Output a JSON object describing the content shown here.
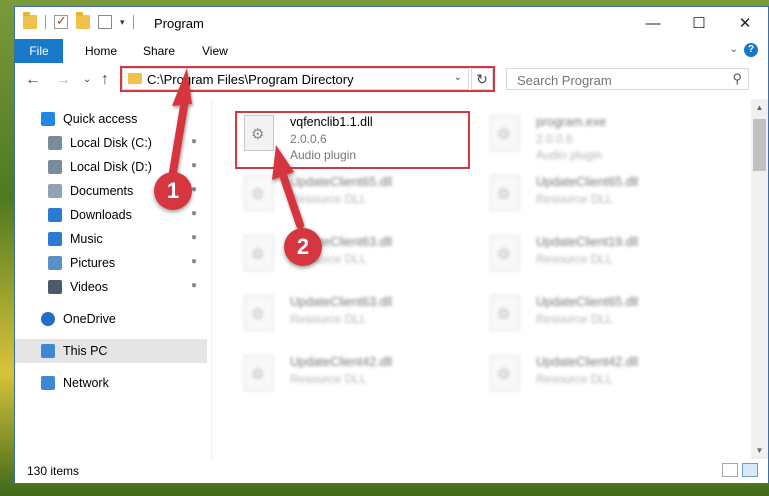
{
  "window": {
    "title": "Program",
    "controls": {
      "minimize": "—",
      "maximize": "☐",
      "close": "✕"
    }
  },
  "ribbon": {
    "tabs": [
      "File",
      "Home",
      "Share",
      "View"
    ],
    "help_icon": "?",
    "expand_icon": "⌄"
  },
  "nav": {
    "back": "←",
    "forward": "→",
    "recent": "⌄",
    "up": "↑",
    "address": "C:\\Program Files\\Program Directory",
    "address_caret": "⌄",
    "refresh": "↻",
    "search_placeholder": "Search Program",
    "search_icon": "⚲"
  },
  "sidebar": {
    "items": [
      {
        "label": "Quick access",
        "icon": "star-icon",
        "color": "#1e88e5"
      },
      {
        "label": "Local Disk (C:)",
        "icon": "drive-icon",
        "color": "#7a8b99",
        "pinned": true
      },
      {
        "label": "Local Disk (D:)",
        "icon": "drive-icon",
        "color": "#7a8b99",
        "pinned": true
      },
      {
        "label": "Documents",
        "icon": "documents-icon",
        "color": "#8fa3b5",
        "pinned": true
      },
      {
        "label": "Downloads",
        "icon": "downloads-icon",
        "color": "#2a7bd1",
        "pinned": true
      },
      {
        "label": "Music",
        "icon": "music-icon",
        "color": "#2a7bd1",
        "pinned": true
      },
      {
        "label": "Pictures",
        "icon": "pictures-icon",
        "color": "#5b8fc7",
        "pinned": true
      },
      {
        "label": "Videos",
        "icon": "videos-icon",
        "color": "#4a5a6a",
        "pinned": true
      },
      {
        "label": "OneDrive",
        "icon": "cloud-icon",
        "color": "#1e6fc6"
      },
      {
        "label": "This PC",
        "icon": "computer-icon",
        "color": "#3c8ad6"
      },
      {
        "label": "Network",
        "icon": "network-icon",
        "color": "#3c8ad6"
      }
    ],
    "pin_glyph": "📌"
  },
  "files": [
    {
      "name": "vqfenclib1.1.dll",
      "meta1": "2.0.0.6",
      "meta2": "Audio plugin"
    },
    {
      "name": "program.exe",
      "meta1": "2.0.0.6",
      "meta2": "Audio plugin"
    },
    {
      "name": "UpdateClient65.dll",
      "meta1": "Resource DLL",
      "meta2": ""
    },
    {
      "name": "UpdateClient65.dll",
      "meta1": "Resource DLL",
      "meta2": ""
    },
    {
      "name": "UpdateClient63.dll",
      "meta1": "Resource DLL",
      "meta2": ""
    },
    {
      "name": "UpdateClient19.dll",
      "meta1": "Resource DLL",
      "meta2": ""
    },
    {
      "name": "UpdateClient63.dll",
      "meta1": "Resource DLL",
      "meta2": ""
    },
    {
      "name": "UpdateClient65.dll",
      "meta1": "Resource DLL",
      "meta2": ""
    },
    {
      "name": "UpdateClient42.dll",
      "meta1": "Resource DLL",
      "meta2": ""
    },
    {
      "name": "UpdateClient42.dll",
      "meta1": "Resource DLL",
      "meta2": ""
    }
  ],
  "status": {
    "item_count": "130 items"
  },
  "callouts": [
    "1",
    "2"
  ],
  "colors": {
    "accent": "#1979ca",
    "highlight": "#d63640"
  }
}
